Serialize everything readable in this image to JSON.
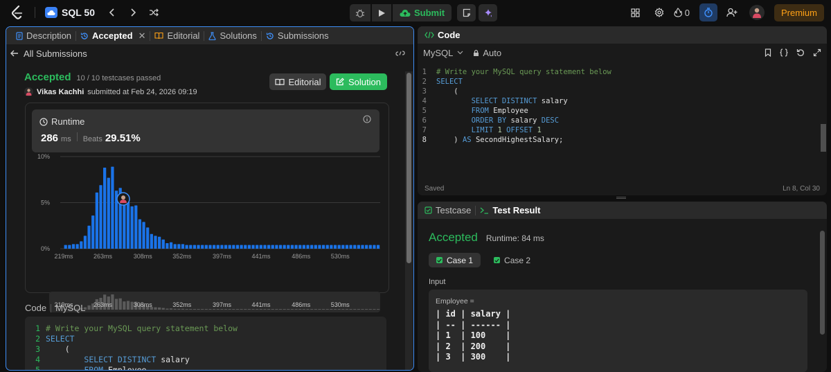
{
  "topbar": {
    "problem_list": "SQL 50",
    "submit": "Submit",
    "streak": "0",
    "premium": "Premium"
  },
  "left_panel": {
    "tabs": [
      {
        "label": "Description"
      },
      {
        "label": "Accepted"
      },
      {
        "label": "Editorial"
      },
      {
        "label": "Solutions"
      },
      {
        "label": "Submissions"
      }
    ],
    "back_label": "All Submissions",
    "status": "Accepted",
    "testcases": "10 / 10 testcases passed",
    "user": "Vikas Kachhi",
    "submitted": "submitted at Feb 24, 2026 09:19",
    "editorial_btn": "Editorial",
    "solution_btn": "Solution",
    "runtime": {
      "title": "Runtime",
      "value": "286",
      "unit": "ms",
      "beats_label": "Beats",
      "beats_value": "29.51%"
    },
    "code_label": "Code",
    "lang_label": "MySQL"
  },
  "chart_data": {
    "type": "bar",
    "title": "",
    "xlabel": "",
    "ylabel": "",
    "ylim": [
      0,
      10
    ],
    "y_ticks": [
      "0%",
      "5%",
      "10%"
    ],
    "x_ticks": [
      "219ms",
      "263ms",
      "308ms",
      "352ms",
      "397ms",
      "441ms",
      "486ms",
      "530ms"
    ],
    "x_range": [
      219,
      575
    ],
    "bin_width": 4.4,
    "highlight_x": 286,
    "values": [
      0.4,
      0.4,
      0.5,
      0.5,
      0.8,
      1.4,
      2.5,
      3.6,
      6.1,
      6.9,
      8.8,
      7.7,
      8.9,
      6.3,
      6.6,
      4.8,
      5.1,
      4.6,
      4.7,
      3.2,
      2.9,
      2.3,
      1.6,
      1.4,
      1.3,
      1.0,
      0.6,
      0.7,
      0.5,
      0.5,
      0.5,
      0.4,
      0.4,
      0.4,
      0.4,
      0.4,
      0.4,
      0.4,
      0.4,
      0.4,
      0.4,
      0.4,
      0.4,
      0.4,
      0.4,
      0.4,
      0.4,
      0.4,
      0.4,
      0.4,
      0.4,
      0.4,
      0.4,
      0.4,
      0.4,
      0.4,
      0.4,
      0.4,
      0.4,
      0.4,
      0.4,
      0.4,
      0.4,
      0.4,
      0.4,
      0.4,
      0.4,
      0.4,
      0.4,
      0.4,
      0.4,
      0.4,
      0.4,
      0.4,
      0.4,
      0.4,
      0.4,
      0.4,
      0.4,
      0.4,
      0.4
    ],
    "grid": true
  },
  "submission_code": [
    "# Write your MySQL query statement below",
    "SELECT",
    "    (",
    "        SELECT DISTINCT salary",
    "        FROM Employee"
  ],
  "code_panel": {
    "title": "Code",
    "language": "MySQL",
    "mode": "Auto",
    "lines": [
      "# Write your MySQL query statement below",
      "SELECT",
      "    (",
      "        SELECT DISTINCT salary",
      "        FROM Employee",
      "        ORDER BY salary DESC",
      "        LIMIT 1 OFFSET 1",
      "    ) AS SecondHighestSalary;"
    ],
    "status_left": "Saved",
    "status_right": "Ln 8, Col 30"
  },
  "result_panel": {
    "tab_testcase": "Testcase",
    "tab_result": "Test Result",
    "status": "Accepted",
    "runtime": "Runtime: 84 ms",
    "cases": [
      "Case 1",
      "Case 2"
    ],
    "input_label": "Input",
    "table_name": "Employee =",
    "table_lines": [
      "| id | salary |",
      "| -- | ------ |",
      "| 1  | 100    |",
      "| 2  | 200    |",
      "| 3  | 300    |"
    ]
  },
  "colors": {
    "accent_green": "#2cbb5d",
    "accent_blue": "#3e8ef7",
    "bar": "#1a73e8",
    "premium": "#ffa116"
  }
}
